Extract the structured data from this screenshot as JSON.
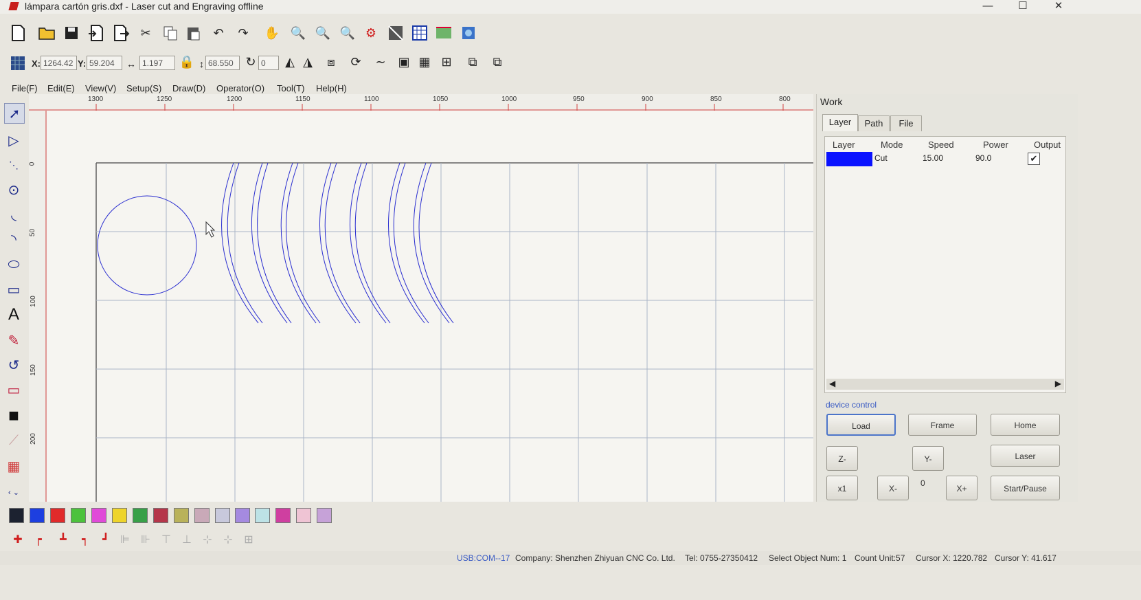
{
  "window": {
    "title": "lámpara cartón gris.dxf - Laser cut and Engraving offline",
    "minimize": "—",
    "maximize": "☐",
    "close": "✕"
  },
  "toolbar": {
    "icons": [
      "new-file-icon",
      "open-folder-icon",
      "save-icon",
      "import-icon",
      "export-icon",
      "cut-icon",
      "copy-icon",
      "paste-icon",
      "undo-icon",
      "redo-icon",
      "pan-hand-icon",
      "zoom-select-icon",
      "zoom-in-icon",
      "zoom-out-icon",
      "settings-gear-icon",
      "array-icon",
      "grid-icon",
      "simulate-icon",
      "laser-output-icon"
    ]
  },
  "coords": {
    "x_label": "X:",
    "x_value": "1264.42",
    "y_label": "Y:",
    "y_value": "59.204",
    "w_value": "1.197",
    "h_value": "68.550",
    "rotate_value": "0"
  },
  "menu": {
    "file": "File(F)",
    "edit": "Edit(E)",
    "view": "View(V)",
    "setup": "Setup(S)",
    "draw": "Draw(D)",
    "operator": "Operator(O)",
    "tool": "Tool(T)",
    "help": "Help(H)"
  },
  "ruler": {
    "h_labels": [
      "1300",
      "1250",
      "1200",
      "1150",
      "1100",
      "1050",
      "1000",
      "950",
      "900",
      "850",
      "800"
    ],
    "v_labels": [
      "0",
      "50",
      "100",
      "150",
      "200"
    ]
  },
  "work": {
    "title": "Work",
    "tabs": [
      "Layer",
      "Path",
      "File"
    ],
    "columns": [
      "Layer",
      "Mode",
      "Speed",
      "Power",
      "Output"
    ],
    "row": {
      "color": "#0a12ff",
      "mode": "Cut",
      "speed": "15.00",
      "power": "90.0",
      "output": "✔"
    }
  },
  "device": {
    "label": "device control",
    "load": "Load",
    "frame": "Frame",
    "home": "Home",
    "z_minus": "Z-",
    "y_minus": "Y-",
    "laser": "Laser",
    "x1": "x1",
    "x_minus": "X-",
    "step": "0",
    "x_plus": "X+",
    "start_pause": "Start/Pause"
  },
  "palette": [
    "#1c2230",
    "#1d3fe0",
    "#e12a2a",
    "#4cc23c",
    "#e04ad8",
    "#eed42a",
    "#38a048",
    "#b5364a",
    "#b9b25a",
    "#c9a9b8",
    "#c8c9dc",
    "#a58ae0",
    "#bde2e6",
    "#cf3fa0",
    "#efc4d4",
    "#c6a2d8"
  ],
  "status": {
    "port": "USB:COM--17",
    "company": "Company: Shenzhen Zhiyuan CNC Co. Ltd.",
    "tel": "Tel: 0755-27350412",
    "select": "Select Object Num: 1",
    "count": "Count Unit:57",
    "cursor_x": "Cursor X: 1220.782",
    "cursor_y": "Cursor Y: 41.617"
  }
}
